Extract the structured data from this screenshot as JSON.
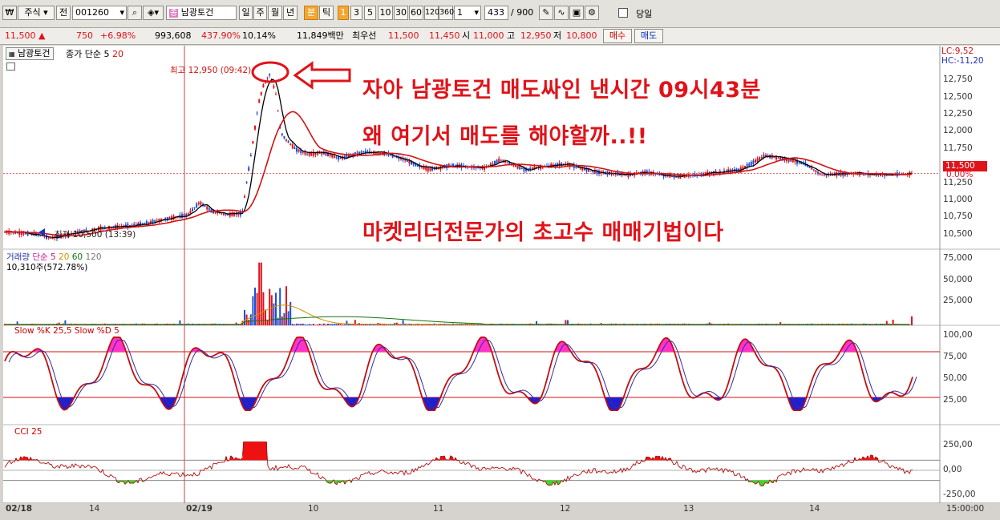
{
  "toolbar": {
    "market": "주식",
    "market_prefix": "전",
    "code": "001260",
    "stock_name": "남광토건",
    "stock_badge": "종",
    "periods": [
      "일",
      "주",
      "월",
      "년",
      "분",
      "틱"
    ],
    "active_period": "분",
    "minute_values": [
      "1",
      "3",
      "5",
      "10",
      "30",
      "60",
      "120",
      "360"
    ],
    "minute_input": "1",
    "count": "433",
    "count_max": "/ 900",
    "today_checkbox_label": "당일"
  },
  "quote": {
    "price": "11,500",
    "change": "750",
    "change_pct": "+6.98%",
    "volume": "993,608",
    "volume_ratio": "437.90%",
    "turnover_pct": "10.14%",
    "amount": "11,849백만",
    "best_label": "최우선",
    "best_ask": "11,500",
    "best_bid": "11,450",
    "open_label": "시",
    "open": "11,000",
    "high_label": "고",
    "high": "12,950",
    "low_label": "저",
    "low": "10,800",
    "buy_button": "매수",
    "sell_button": "매도"
  },
  "panels": {
    "price": {
      "tab": "남광토건",
      "ma_label": "종가 단순 5",
      "ma_period2": "20",
      "high_note": "최고 12,950 (09:42)",
      "low_note": "최저 10,500 (13:39)",
      "lc": "LC:9,52",
      "hc": "HC:-11,20",
      "current_price": "11,500",
      "current_pct": "0.00%",
      "y_ticks": [
        "12,750",
        "12,500",
        "12,250",
        "12,000",
        "11,750",
        "11,500",
        "11,250",
        "11,000",
        "10,750",
        "10,500"
      ]
    },
    "volume": {
      "label": "거래량",
      "ma_label": "단순 5",
      "periods": [
        "20",
        "60",
        "120"
      ],
      "value_note": "10,310주(572.78%)",
      "y_ticks": [
        "75,000",
        "50,000",
        "25,000"
      ]
    },
    "stoch": {
      "label": "Slow %K 25,5  Slow %D 5",
      "y_ticks": [
        "100,00",
        "75,00",
        "50,00",
        "25,00"
      ]
    },
    "cci": {
      "label": "CCI 25",
      "y_ticks": [
        "250,00",
        "0,00",
        "-250,00"
      ]
    }
  },
  "x_axis": [
    "02/18",
    "14",
    "02/19",
    "10",
    "11",
    "12",
    "13",
    "14"
  ],
  "time_label": "15:00:00",
  "annotations": {
    "line1": "자아 남광토건 매도싸인 낸시간 09시43분",
    "line2": "왜 여기서 매도를 해야할까..!!",
    "line3": "마켓리더전문가의 초고수 매매기법이다"
  },
  "colors": {
    "annotation": "#e0131a",
    "up": "#e0131a",
    "down": "#1e4fd6",
    "ma_fast": "#000000",
    "ma_slow": "#d11212",
    "stoch_overbought": "#ff33cc",
    "stoch_oversold": "#1f1fd0",
    "cci_up": "#ee1111",
    "cci_down": "#33dd22"
  }
}
